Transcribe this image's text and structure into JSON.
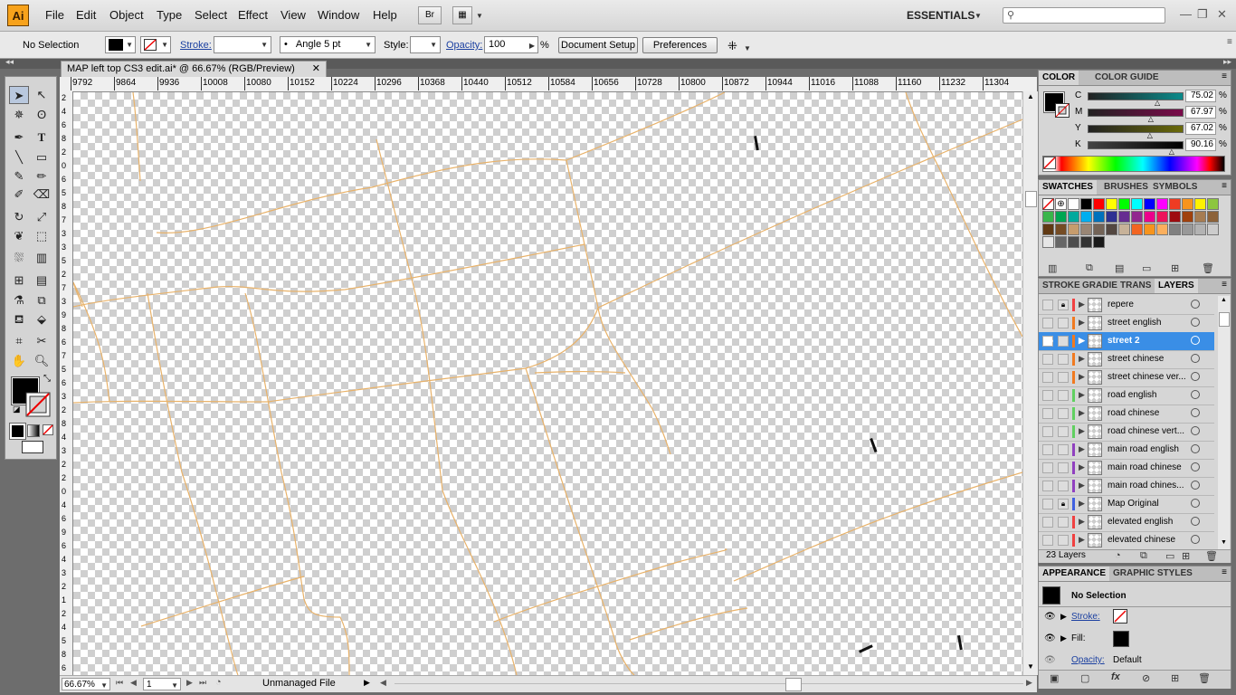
{
  "app": {
    "logo": "Ai"
  },
  "menu": {
    "items": [
      "File",
      "Edit",
      "Object",
      "Type",
      "Select",
      "Effect",
      "View",
      "Window",
      "Help"
    ]
  },
  "workspace": {
    "label": "ESSENTIALS"
  },
  "control_bar": {
    "selection": "No Selection",
    "stroke_label": "Stroke:",
    "brush": "Angle 5 pt",
    "style_label": "Style:",
    "opacity_label": "Opacity:",
    "opacity_value": "100",
    "percent": "%",
    "document_setup": "Document Setup",
    "preferences": "Preferences"
  },
  "document": {
    "tab_title": "MAP left top CS3 edit.ai* @ 66.67% (RGB/Preview)",
    "ruler_marks": [
      "9792",
      "9864",
      "9936",
      "10008",
      "10080",
      "10152",
      "10224",
      "10296",
      "10368",
      "10440",
      "10512",
      "10584",
      "10656",
      "10728",
      "10800",
      "10872",
      "10944",
      "11016",
      "11088",
      "11160",
      "11232",
      "11304"
    ],
    "vruler_marks": [
      "2",
      "4",
      "6",
      "8",
      "2",
      "0",
      "6",
      "5",
      "8",
      "7",
      "3",
      "3",
      "5",
      "2",
      "7",
      "3",
      "9",
      "8",
      "6",
      "7",
      "5",
      "6",
      "3",
      "2",
      "8",
      "4",
      "3",
      "2",
      "2",
      "0",
      "4",
      "6",
      "9",
      "6",
      "4",
      "3",
      "2",
      "1",
      "2",
      "4",
      "5",
      "8",
      "6"
    ],
    "zoom": "66.67%",
    "page": "1",
    "status": "Unmanaged File",
    "road_color": "#e8b26a"
  },
  "color_panel": {
    "tabs": [
      "COLOR",
      "COLOR GUIDE"
    ],
    "channels": [
      {
        "name": "C",
        "value": "75.02"
      },
      {
        "name": "M",
        "value": "67.97"
      },
      {
        "name": "Y",
        "value": "67.02"
      },
      {
        "name": "K",
        "value": "90.16"
      }
    ],
    "percent": "%"
  },
  "swatches_panel": {
    "tabs": [
      "SWATCHES",
      "BRUSHES",
      "SYMBOLS"
    ],
    "colors": [
      "#ffffff",
      "#000000",
      "#ff0000",
      "#ffff00",
      "#00ff00",
      "#00ffff",
      "#0000ff",
      "#ff00ff",
      "#ee3c23",
      "#f7941d",
      "#fff200",
      "#8dc63f",
      "#39b54a",
      "#00a651",
      "#00a99d",
      "#00aeef",
      "#0072bc",
      "#2e3192",
      "#662d91",
      "#92278f",
      "#ec008c",
      "#ed145b",
      "#9e0b0f",
      "#a0410d",
      "#a67c52",
      "#8c6239",
      "#603913",
      "#754c24",
      "#c69c6d",
      "#998675",
      "#736357",
      "#534741",
      "#c7b299",
      "#f26522",
      "#f7941d",
      "#fbaf5d",
      "#808080",
      "#999999",
      "#b3b3b3",
      "#cccccc",
      "#e6e6e6",
      "#666666",
      "#4d4d4d",
      "#333333",
      "#1a1a1a"
    ]
  },
  "layers_panel": {
    "tabs": [
      "STROKE",
      "GRADIE",
      "TRANS",
      "LAYERS"
    ],
    "layers": [
      {
        "name": "repere",
        "color": "#f04040",
        "visible": false,
        "locked": true,
        "selected": false
      },
      {
        "name": "street english",
        "color": "#f07a20",
        "visible": false,
        "locked": false,
        "selected": false
      },
      {
        "name": "street 2",
        "color": "#f07a20",
        "visible": true,
        "locked": false,
        "selected": true
      },
      {
        "name": "street chinese",
        "color": "#f07a20",
        "visible": false,
        "locked": false,
        "selected": false
      },
      {
        "name": "street chinese ver...",
        "color": "#f07a20",
        "visible": false,
        "locked": false,
        "selected": false
      },
      {
        "name": "road english",
        "color": "#60d060",
        "visible": false,
        "locked": false,
        "selected": false
      },
      {
        "name": "road chinese",
        "color": "#60d060",
        "visible": false,
        "locked": false,
        "selected": false
      },
      {
        "name": "road chinese vert...",
        "color": "#60d060",
        "visible": false,
        "locked": false,
        "selected": false
      },
      {
        "name": "main road english",
        "color": "#9040c0",
        "visible": false,
        "locked": false,
        "selected": false
      },
      {
        "name": "main road chinese",
        "color": "#9040c0",
        "visible": false,
        "locked": false,
        "selected": false
      },
      {
        "name": "main road chines...",
        "color": "#9040c0",
        "visible": false,
        "locked": false,
        "selected": false
      },
      {
        "name": "Map Original",
        "color": "#4060e0",
        "visible": false,
        "locked": true,
        "selected": false
      },
      {
        "name": "elevated english",
        "color": "#f04040",
        "visible": false,
        "locked": false,
        "selected": false
      },
      {
        "name": "elevated chinese",
        "color": "#f04040",
        "visible": false,
        "locked": false,
        "selected": false
      }
    ],
    "count": "23 Layers"
  },
  "appearance_panel": {
    "tabs": [
      "APPEARANCE",
      "GRAPHIC STYLES"
    ],
    "selection": "No Selection",
    "stroke_label": "Stroke:",
    "fill_label": "Fill:",
    "opacity_label": "Opacity:",
    "opacity_value": "Default"
  }
}
